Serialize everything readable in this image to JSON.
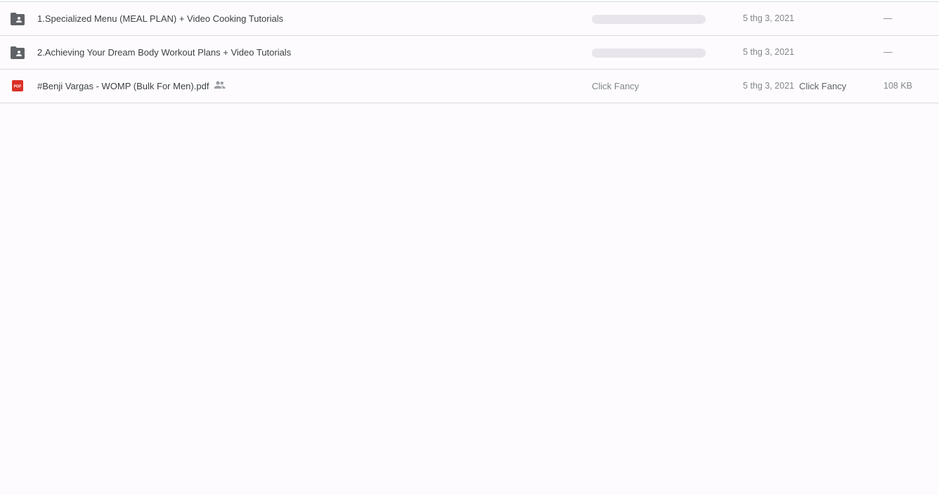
{
  "files": [
    {
      "name": "1.Specialized Menu (MEAL PLAN) + Video Cooking Tutorials",
      "icon": "shared-folder-icon",
      "modified": "5 thg 3, 2021",
      "size": "—"
    },
    {
      "name": "2.Achieving Your Dream Body Workout Plans + Video Tutorials",
      "icon": "shared-folder-icon",
      "modified": "5 thg 3, 2021",
      "size": "—"
    },
    {
      "name": "#Benji Vargas - WOMP (Bulk For Men).pdf",
      "icon": "pdf-icon",
      "icon_label": "PDF",
      "shared_icon": "people-icon",
      "owner": "Click Fancy",
      "modified": "5 thg 3, 2021",
      "modified_by": "Click Fancy",
      "size": "108 KB"
    }
  ],
  "colors": {
    "background": "#fdfbfe",
    "folder_icon": "#5f6368",
    "pdf_red": "#d93025",
    "divider": "#dadce0",
    "skeleton": "#e8e6ec"
  }
}
